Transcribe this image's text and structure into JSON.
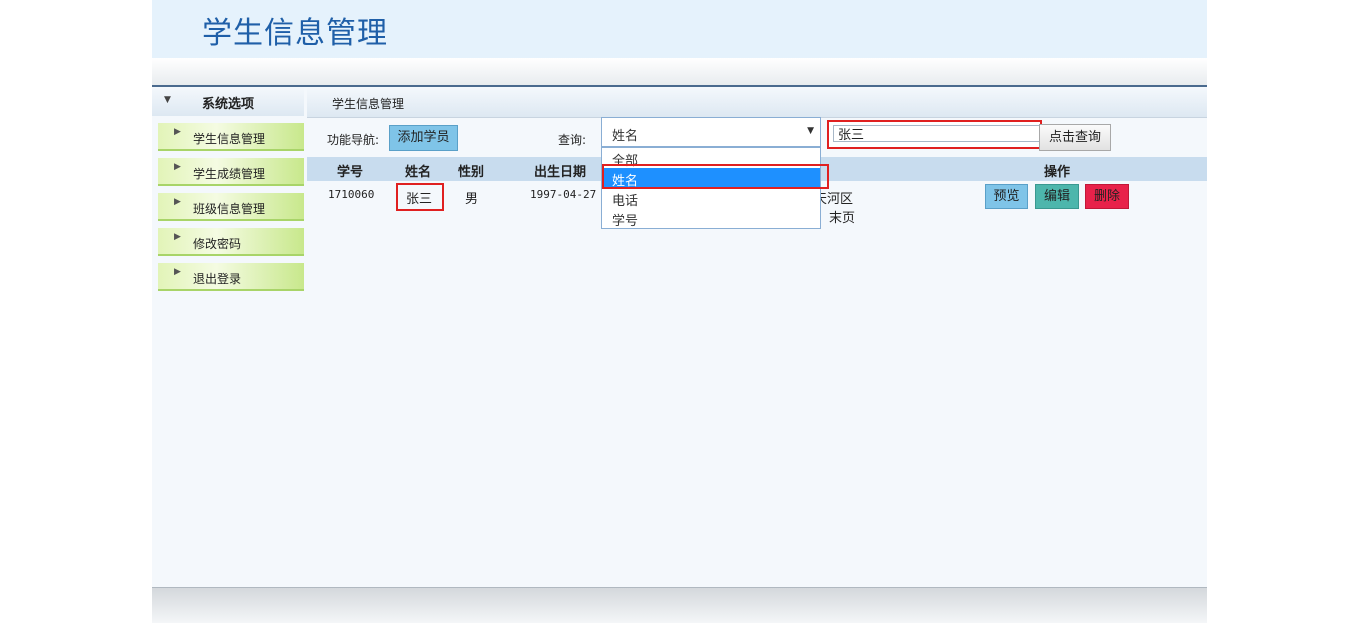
{
  "app": {
    "title": "学生信息管理"
  },
  "sidebar": {
    "header": "系统选项",
    "items": [
      {
        "label": "学生信息管理"
      },
      {
        "label": "学生成绩管理"
      },
      {
        "label": "班级信息管理"
      },
      {
        "label": "修改密码"
      },
      {
        "label": "退出登录"
      }
    ]
  },
  "main": {
    "breadcrumb": "学生信息管理",
    "toolbar": {
      "nav_label": "功能导航:",
      "add_button": "添加学员",
      "query_label": "查询:",
      "field_select": {
        "selected": "姓名",
        "options": [
          "全部",
          "姓名",
          "电话",
          "学号"
        ]
      },
      "search_value": "张三",
      "search_button": "点击查询"
    },
    "table": {
      "columns": [
        "学号",
        "姓名",
        "性别",
        "出生日期",
        "操作"
      ],
      "rows": [
        {
          "id": "1710060",
          "name": "张三",
          "gender": "男",
          "birth": "1997-04-27",
          "address_fragment": "天河区"
        }
      ],
      "actions": [
        "预览",
        "编辑",
        "删除"
      ],
      "pager_fragment": "末页"
    }
  },
  "colors": {
    "title": "#1f5fa8",
    "preview_button": "#7fc4e8",
    "edit_button": "#4db6ac",
    "delete_button": "#e8224a",
    "highlight_border": "#e02020",
    "selected_option": "#1e90ff"
  }
}
